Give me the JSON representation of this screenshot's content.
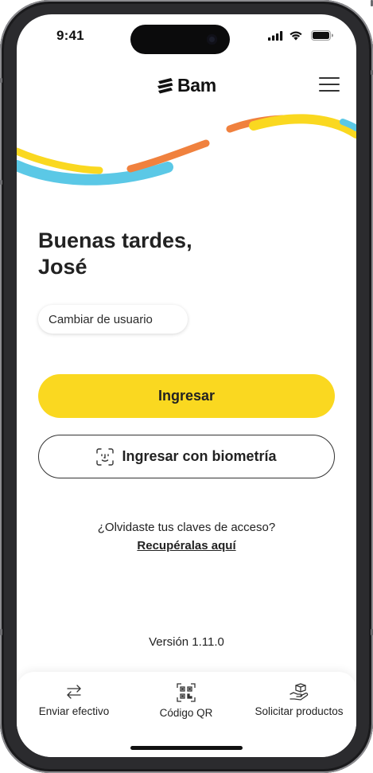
{
  "status_bar": {
    "time": "9:41",
    "icons": [
      "cellular-signal-icon",
      "wifi-icon",
      "battery-icon"
    ]
  },
  "header": {
    "brand": "Bam",
    "menu_icon": "hamburger-menu-icon"
  },
  "greeting": {
    "line1": "Buenas tardes,",
    "line2": "José"
  },
  "change_user_label": "Cambiar de usuario",
  "primary_button_label": "Ingresar",
  "biometric_button": {
    "label": "Ingresar con biometría",
    "icon": "face-id-icon"
  },
  "forgot": {
    "question": "¿Olvidaste tus claves de acceso?",
    "link": "Recupéralas aquí"
  },
  "version": "Versión 1.11.0",
  "bottom_nav": [
    {
      "label": "Enviar efectivo",
      "icon": "transfer-arrows-icon"
    },
    {
      "label": "Código QR",
      "icon": "qr-code-icon"
    },
    {
      "label": "Solicitar productos",
      "icon": "hand-box-icon"
    }
  ],
  "colors": {
    "brand_yellow": "#fad820",
    "wave_blue": "#5bc8e6",
    "wave_orange": "#f0813e",
    "text_dark": "#222222"
  }
}
